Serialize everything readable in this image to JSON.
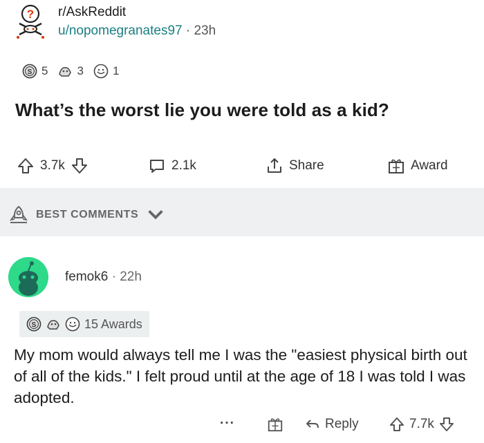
{
  "post": {
    "subreddit": "r/AskReddit",
    "user": "u/nopomegranates97",
    "separator": "·",
    "time": "23h",
    "awards": [
      {
        "icon": "silver-award-icon",
        "count": "5"
      },
      {
        "icon": "helpful-award-icon",
        "count": "3"
      },
      {
        "icon": "wholesome-award-icon",
        "count": "1"
      }
    ],
    "title": "What’s the worst lie you were told as a kid?",
    "actions": {
      "upvotes": "3.7k",
      "comments": "2.1k",
      "share": "Share",
      "award": "Award"
    }
  },
  "sort": {
    "label": "BEST COMMENTS"
  },
  "comment": {
    "user": "femok6",
    "separator": "·",
    "time": "22h",
    "awards_label": "15 Awards",
    "body": "My mom would always tell me I was the \"easiest physical birth out of all of the kids.\" I felt proud until at the age of 18 I was told I was adopted.",
    "actions": {
      "more": "···",
      "reply": "Reply",
      "upvotes": "7.7k"
    }
  },
  "colors": {
    "username": "#1a7f83",
    "avatar": "#2fd98a",
    "band": "#eef0f1"
  }
}
